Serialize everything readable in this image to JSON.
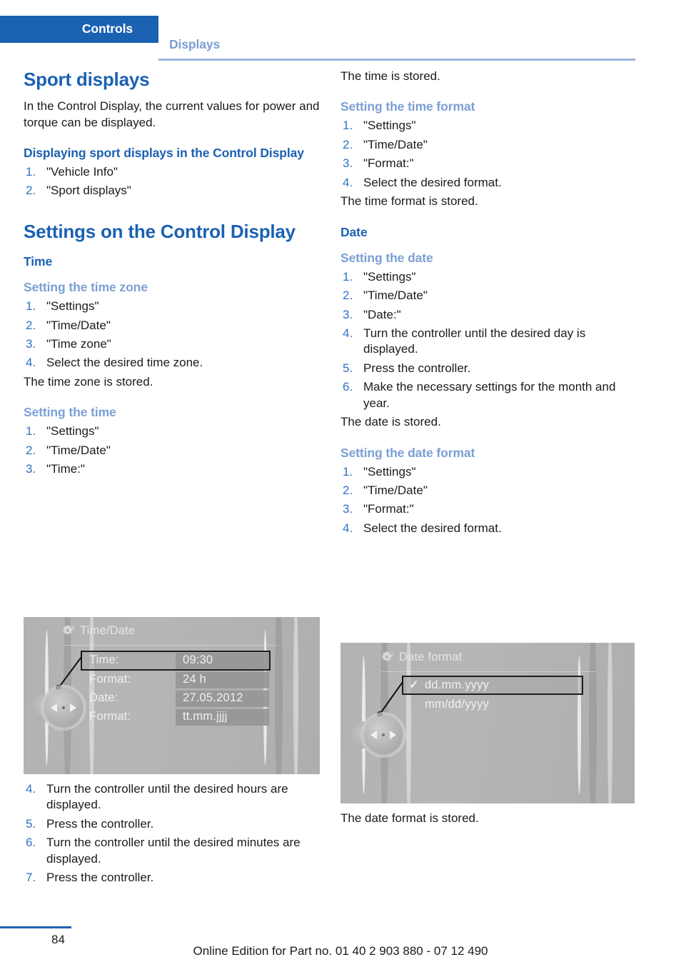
{
  "header": {
    "active_tab": "Controls",
    "inactive_tab": "Displays",
    "accent_color": "#1b61b2",
    "muted_accent_color": "#7b9fd4"
  },
  "left_column": {
    "sport_displays": {
      "title": "Sport displays",
      "intro": "In the Control Display, the current values for power and torque can be displayed.",
      "subheading": "Displaying sport displays in the Control Display",
      "steps": [
        "\"Vehicle Info\"",
        "\"Sport displays\""
      ]
    },
    "settings_control_display": {
      "title": "Settings on the Control Display",
      "time_heading": "Time",
      "time_zone": {
        "heading": "Setting the time zone",
        "steps": [
          "\"Settings\"",
          "\"Time/Date\"",
          "\"Time zone\"",
          "Select the desired time zone."
        ],
        "result": "The time zone is stored."
      },
      "setting_time": {
        "heading": "Setting the time",
        "steps_before": [
          "\"Settings\"",
          "\"Time/Date\"",
          "\"Time:\""
        ],
        "steps_after": [
          "Turn the controller until the desired hours are displayed.",
          "Press the controller.",
          "Turn the controller until the desired minutes are displayed.",
          "Press the controller."
        ]
      }
    },
    "time_date_screen": {
      "icon": "gear-icon",
      "title": "Time/Date",
      "rows": [
        {
          "label": "Time:",
          "value": "09:30",
          "selected": true
        },
        {
          "label": "Format:",
          "value": "24 h",
          "selected": false
        },
        {
          "label": "Date:",
          "value": "27.05.2012",
          "selected": false
        },
        {
          "label": "Format:",
          "value": "tt.mm.jjjj",
          "selected": false
        }
      ]
    }
  },
  "right_column": {
    "time_stored": "The time is stored.",
    "time_format": {
      "heading": "Setting the time format",
      "steps": [
        "\"Settings\"",
        "\"Time/Date\"",
        "\"Format:\"",
        "Select the desired format."
      ],
      "result": "The time format is stored."
    },
    "date_heading": "Date",
    "setting_date": {
      "heading": "Setting the date",
      "steps": [
        "\"Settings\"",
        "\"Time/Date\"",
        "\"Date:\"",
        "Turn the controller until the desired day is displayed.",
        "Press the controller.",
        "Make the necessary settings for the month and year."
      ],
      "result": "The date is stored."
    },
    "date_format": {
      "heading": "Setting the date format",
      "steps": [
        "\"Settings\"",
        "\"Time/Date\"",
        "\"Format:\"",
        "Select the desired format."
      ],
      "result": "The date format is stored."
    },
    "date_format_screen": {
      "icon": "gear-icon",
      "title": "Date format",
      "options": [
        {
          "label": "dd.mm.yyyy",
          "checked": true,
          "selected": true
        },
        {
          "label": "mm/dd/yyyy",
          "checked": false,
          "selected": false
        }
      ]
    }
  },
  "footer": {
    "page_number": "84",
    "note": "Online Edition for Part no. 01 40 2 903 880 - 07 12 490"
  }
}
